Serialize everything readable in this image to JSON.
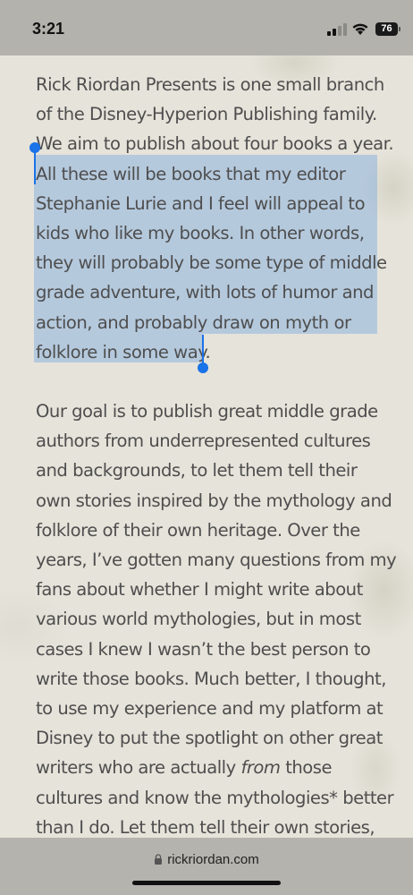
{
  "status_bar": {
    "time": "3:21",
    "battery": "76",
    "icons": [
      "signal-icon",
      "wifi-icon",
      "battery-icon"
    ]
  },
  "article": {
    "paragraphs": [
      {
        "lines": [
          "Rick Riordan Presents is one small branch",
          "of the Disney-Hyperion Publishing family.",
          "We aim to publish about four books a year.",
          "All these will be books that my editor",
          "Stephanie Lurie and I feel will appeal to",
          "kids who like my books. In other words,",
          "they will probably be some type of middle",
          "grade adventure, with lots of humor and",
          "action, and probably draw on myth or",
          "folklore in some way."
        ]
      },
      {
        "lines": [
          "Our goal is to publish great middle grade",
          "authors from underrepresented cultures",
          "and backgrounds, to let them tell their",
          "own stories inspired by the mythology and",
          "folklore of their own heritage. Over the",
          "years, I’ve gotten many questions from my",
          "fans about whether I might write about",
          "various world mythologies, but in most",
          "cases I knew I wasn’t the best person to",
          "write those books. Much better, I thought,",
          "to use my experience and my platform at",
          "Disney to put the spotlight on other great"
        ],
        "line_with_italic": {
          "before": "writers who are actually ",
          "italic": "from",
          "after": " those"
        },
        "lines_after": [
          "cultures and know the mythologies* better",
          "than I do. Let them tell their own stories,"
        ]
      }
    ]
  },
  "selection": {
    "start_line": "All these will be books that my editor",
    "end_line": "folklore in some way.",
    "color": "#7aa8e1",
    "handle_color": "#1a73e8"
  },
  "url_bar": {
    "domain": "rickriordan.com",
    "icon": "lock-icon"
  }
}
